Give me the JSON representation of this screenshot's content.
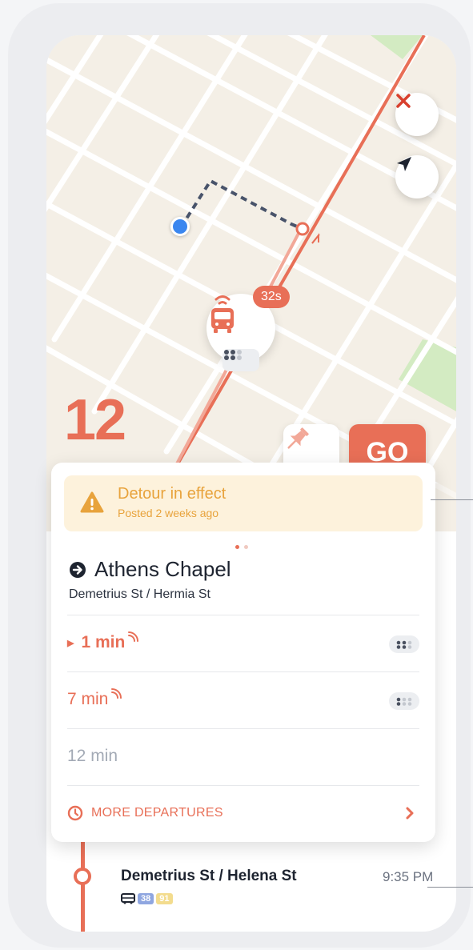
{
  "map": {
    "route_number": "12",
    "bus_eta": "32s",
    "colors": {
      "route": "#e86f57",
      "user": "#3a86ef",
      "park": "#d3ebc2",
      "map_bg": "#f4efe6"
    },
    "controls": {
      "close_icon": "close-icon",
      "locate_icon": "navigation-arrow-icon"
    },
    "pin_icon": "pushpin-icon",
    "go_label": "GO"
  },
  "card": {
    "detour": {
      "title": "Detour in effect",
      "subtitle": "Posted 2 weeks ago",
      "icon": "warning-icon"
    },
    "pager": {
      "pages": 2,
      "current": 1
    },
    "stop": {
      "name": "Athens Chapel",
      "cross_streets": "Demetrius St / Hermia St",
      "icon": "arrow-circle-icon"
    },
    "departures": [
      {
        "time": "1 min",
        "realtime": true,
        "next": true
      },
      {
        "time": "7 min",
        "realtime": true,
        "next": false
      },
      {
        "time": "12 min",
        "realtime": false,
        "next": false
      }
    ],
    "more_departures": "MORE DEPARTURES"
  },
  "next_stop": {
    "name": "Demetrius St / Helena St",
    "time": "9:35 PM",
    "routes": [
      {
        "label": "38",
        "color": "#8fa6e0"
      },
      {
        "label": "91",
        "color": "#f3dc8e"
      }
    ]
  }
}
